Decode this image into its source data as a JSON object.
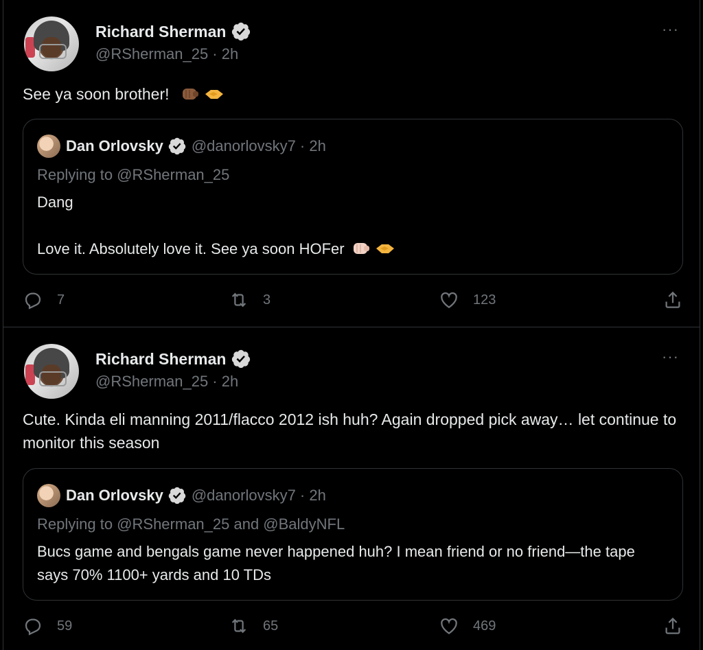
{
  "colors": {
    "background": "#000000",
    "text": "#e7e9ea",
    "secondary": "#71767b",
    "border": "#2f3336",
    "verified": "#d9d9d9"
  },
  "tweets": [
    {
      "author": {
        "name": "Richard Sherman",
        "handle": "@RSherman_25",
        "time": "2h",
        "verified": true
      },
      "handle_line": "@RSherman_25 · 2h",
      "text": "See ya soon brother!",
      "emojis": [
        "fist-bump-emoji",
        "handshake-emoji"
      ],
      "more": "···",
      "quote": {
        "author": {
          "name": "Dan Orlovsky",
          "handle_line": "@danorlovsky7 · 2h",
          "verified": true
        },
        "replying": "Replying to @RSherman_25",
        "lines": [
          "Dang",
          "",
          "Love it. Absolutely love it. See ya soon HOFer"
        ]
      },
      "stats": {
        "replies": "7",
        "retweets": "3",
        "likes": "123"
      }
    },
    {
      "author": {
        "name": "Richard Sherman",
        "handle": "@RSherman_25",
        "time": "2h",
        "verified": true
      },
      "handle_line": "@RSherman_25 · 2h",
      "text": "Cute.  Kinda eli manning 2011/flacco 2012 ish huh?  Again dropped pick away… let continue to monitor this season",
      "more": "···",
      "quote": {
        "author": {
          "name": "Dan Orlovsky",
          "handle_line": "@danorlovsky7 · 2h",
          "verified": true
        },
        "replying": "Replying to @RSherman_25 and @BaldyNFL",
        "lines": [
          "Bucs game and bengals game never happened huh? I mean friend or no friend—the tape says 70% 1100+ yards and 10 TDs"
        ]
      },
      "stats": {
        "replies": "59",
        "retweets": "65",
        "likes": "469"
      }
    }
  ]
}
